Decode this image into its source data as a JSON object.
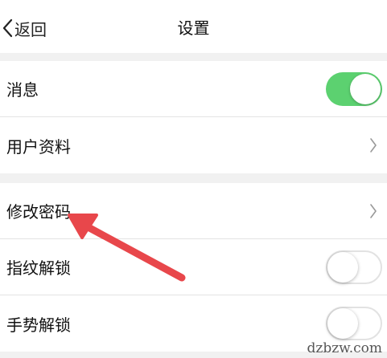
{
  "header": {
    "back_label": "返回",
    "title": "设置"
  },
  "groups": [
    {
      "items": [
        {
          "label": "消息",
          "control": "toggle",
          "on": true
        },
        {
          "label": "用户资料",
          "control": "chevron"
        }
      ]
    },
    {
      "items": [
        {
          "label": "修改密码",
          "control": "chevron"
        },
        {
          "label": "指纹解锁",
          "control": "toggle",
          "on": false
        },
        {
          "label": "手势解锁",
          "control": "toggle",
          "on": false
        }
      ]
    }
  ],
  "icons": {
    "back": "chevron-left-icon",
    "row_arrow": "chevron-right-icon"
  },
  "colors": {
    "toggle_on": "#5cd170",
    "annotation_arrow": "#e8474b",
    "page_background": "#f1f1f1"
  },
  "watermark": "dzbzw.com"
}
